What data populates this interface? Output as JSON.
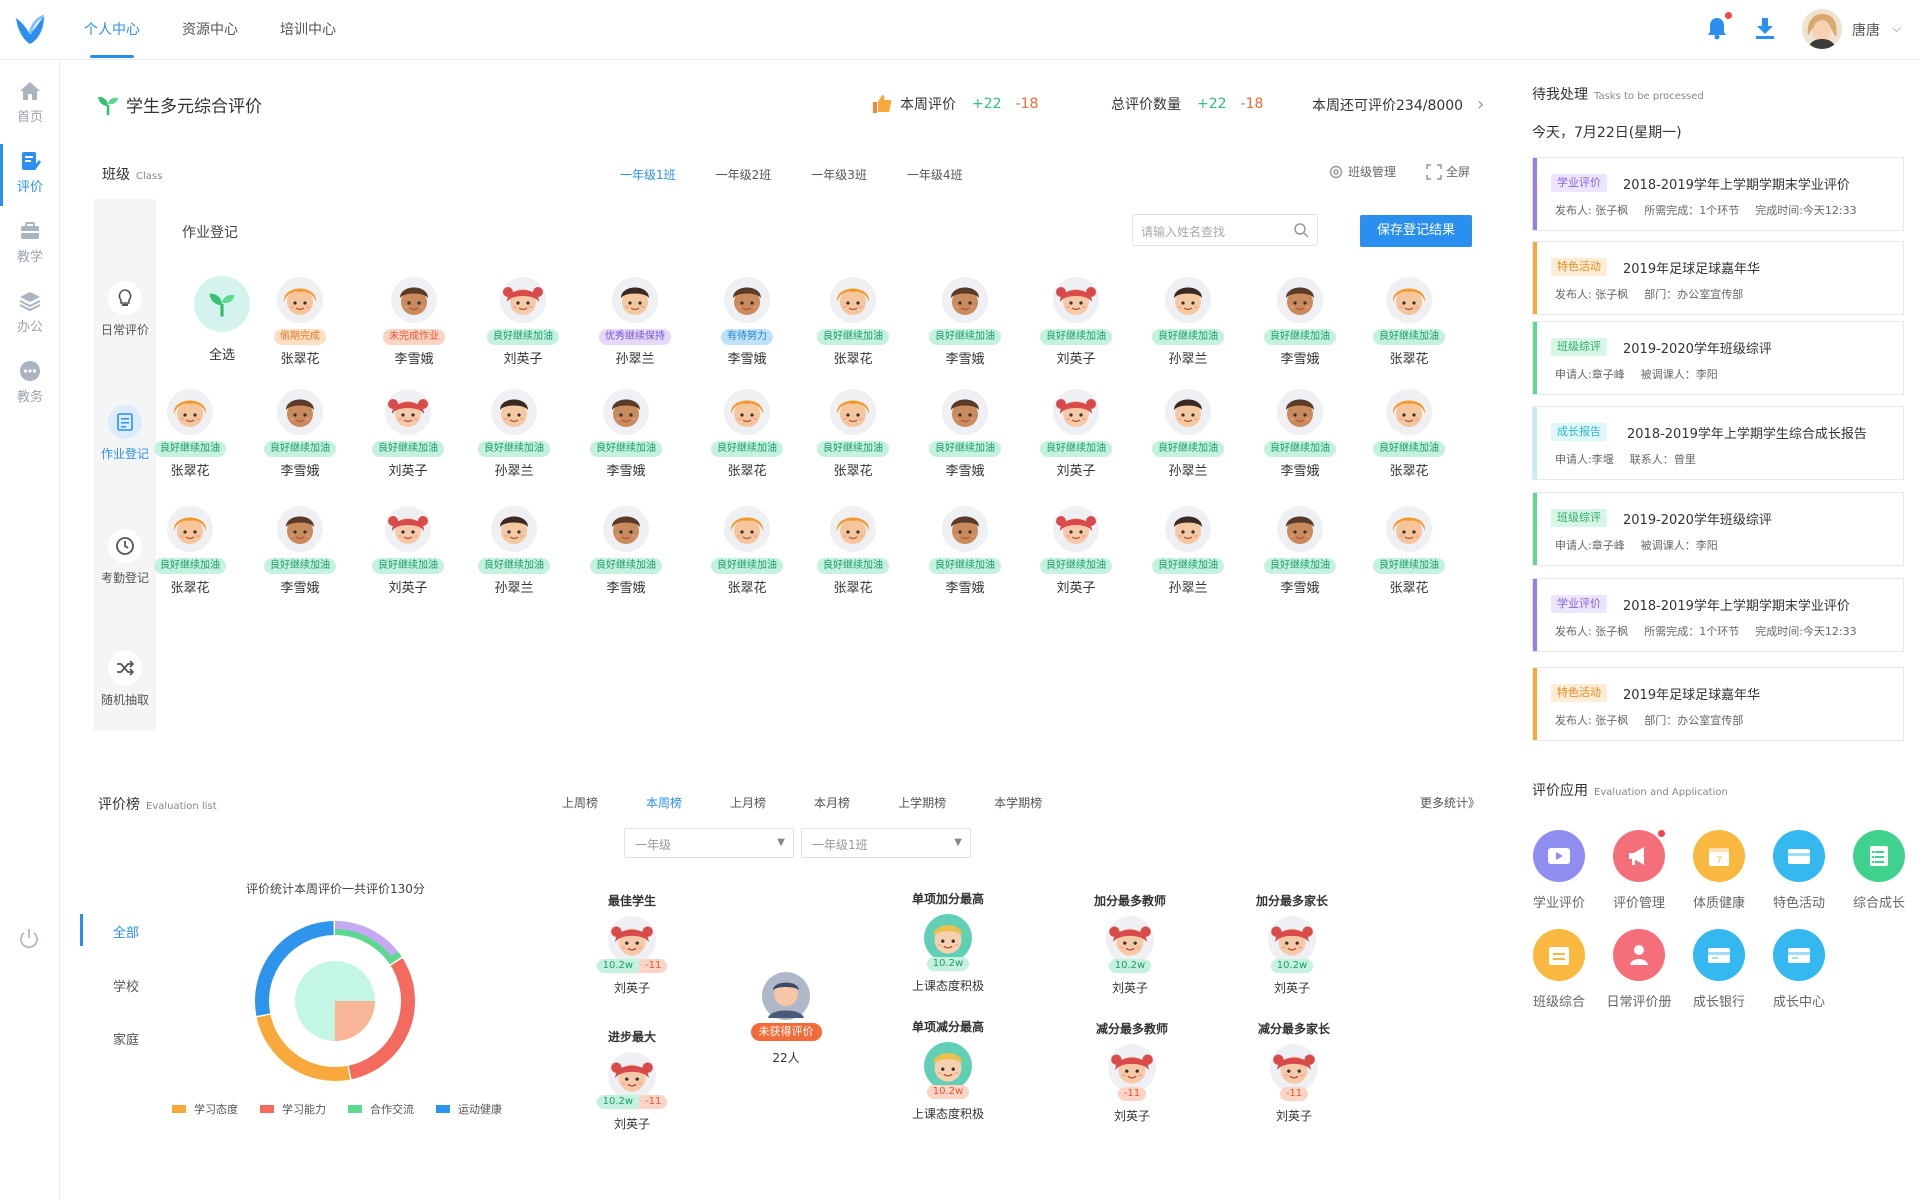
{
  "topbar": {
    "tabs": [
      "个人中心",
      "资源中心",
      "培训中心"
    ],
    "user_name": "唐唐"
  },
  "leftnav": {
    "items": [
      {
        "label": "首页",
        "icon": "home-icon"
      },
      {
        "label": "评价",
        "icon": "edit-doc-icon",
        "active": true
      },
      {
        "label": "教学",
        "icon": "briefcase-icon"
      },
      {
        "label": "办公",
        "icon": "layers-icon"
      },
      {
        "label": "教务",
        "icon": "chat-dots-icon"
      }
    ]
  },
  "header": {
    "title": "学生多元综合评价",
    "week_eval_label": "本周评价",
    "week_eval_plus": "+22",
    "week_eval_minus": "-18",
    "total_label": "总评价数量",
    "total_plus": "+22",
    "total_minus": "-18",
    "remaining": "本周还可评价234/8000"
  },
  "class_section": {
    "title": "班级",
    "title_en": "Class",
    "tabs": [
      "一年级1班",
      "一年级2班",
      "一年级3班",
      "一年级4班"
    ],
    "manage": "班级管理",
    "fullscreen": "全屏"
  },
  "panel": {
    "items": [
      "日常评价",
      "作业登记",
      "考勤登记",
      "随机抽取"
    ],
    "hw_title": "作业登记",
    "search_placeholder": "请输入姓名查找",
    "save_button": "保存登记结果",
    "select_all": "全选"
  },
  "students": [
    [
      {
        "name": "张翠花",
        "badge": "偷期完成",
        "type": "orange",
        "face": "girl-orange"
      },
      {
        "name": "李雪娥",
        "badge": "未完成作业",
        "type": "orange2",
        "face": "boy-brown"
      },
      {
        "name": "刘英子",
        "badge": "良好继续加油",
        "type": "green",
        "face": "girl-red"
      },
      {
        "name": "孙翠兰",
        "badge": "优秀继续保持",
        "type": "purple",
        "face": "boy-black"
      },
      {
        "name": "李雪娥",
        "badge": "有待努力",
        "type": "blue",
        "face": "boy-brown"
      },
      {
        "name": "张翠花",
        "badge": "良好继续加油",
        "type": "green",
        "face": "girl-orange"
      },
      {
        "name": "李雪娥",
        "badge": "良好继续加油",
        "type": "green",
        "face": "boy-brown"
      },
      {
        "name": "刘英子",
        "badge": "良好继续加油",
        "type": "green",
        "face": "girl-red"
      },
      {
        "name": "孙翠兰",
        "badge": "良好继续加油",
        "type": "green",
        "face": "boy-black"
      },
      {
        "name": "李雪娥",
        "badge": "良好继续加油",
        "type": "green",
        "face": "boy-brown"
      },
      {
        "name": "张翠花",
        "badge": "良好继续加油",
        "type": "green",
        "face": "girl-orange"
      }
    ],
    [
      {
        "name": "张翠花",
        "badge": "良好继续加油",
        "type": "green",
        "face": "girl-orange"
      },
      {
        "name": "李雪娥",
        "badge": "良好继续加油",
        "type": "green",
        "face": "boy-brown"
      },
      {
        "name": "刘英子",
        "badge": "良好继续加油",
        "type": "green",
        "face": "girl-red"
      },
      {
        "name": "孙翠兰",
        "badge": "良好继续加油",
        "type": "green",
        "face": "boy-black"
      },
      {
        "name": "李雪娥",
        "badge": "良好继续加油",
        "type": "green",
        "face": "boy-brown"
      },
      {
        "name": "张翠花",
        "badge": "良好继续加油",
        "type": "green",
        "face": "girl-orange"
      },
      {
        "name": "张翠花",
        "badge": "良好继续加油",
        "type": "green",
        "face": "girl-orange"
      },
      {
        "name": "李雪娥",
        "badge": "良好继续加油",
        "type": "green",
        "face": "boy-brown"
      },
      {
        "name": "刘英子",
        "badge": "良好继续加油",
        "type": "green",
        "face": "girl-red"
      },
      {
        "name": "孙翠兰",
        "badge": "良好继续加油",
        "type": "green",
        "face": "boy-black"
      },
      {
        "name": "李雪娥",
        "badge": "良好继续加油",
        "type": "green",
        "face": "boy-brown"
      },
      {
        "name": "张翠花",
        "badge": "良好继续加油",
        "type": "green",
        "face": "girl-orange"
      }
    ],
    [
      {
        "name": "张翠花",
        "badge": "良好继续加油",
        "type": "green",
        "face": "girl-orange"
      },
      {
        "name": "李雪娥",
        "badge": "良好继续加油",
        "type": "green",
        "face": "boy-brown"
      },
      {
        "name": "刘英子",
        "badge": "良好继续加油",
        "type": "green",
        "face": "girl-red"
      },
      {
        "name": "孙翠兰",
        "badge": "良好继续加油",
        "type": "green",
        "face": "boy-black"
      },
      {
        "name": "李雪娥",
        "badge": "良好继续加油",
        "type": "green",
        "face": "boy-brown"
      },
      {
        "name": "张翠花",
        "badge": "良好继续加油",
        "type": "green",
        "face": "girl-orange"
      },
      {
        "name": "张翠花",
        "badge": "良好继续加油",
        "type": "green",
        "face": "girl-orange"
      },
      {
        "name": "李雪娥",
        "badge": "良好继续加油",
        "type": "green",
        "face": "boy-brown"
      },
      {
        "name": "刘英子",
        "badge": "良好继续加油",
        "type": "green",
        "face": "girl-red"
      },
      {
        "name": "孙翠兰",
        "badge": "良好继续加油",
        "type": "green",
        "face": "boy-black"
      },
      {
        "name": "李雪娥",
        "badge": "良好继续加油",
        "type": "green",
        "face": "boy-brown"
      },
      {
        "name": "张翠花",
        "badge": "良好继续加油",
        "type": "green",
        "face": "girl-orange"
      }
    ]
  ],
  "ranking": {
    "title": "评价榜",
    "title_en": "Evaluation list",
    "tabs": [
      "上周榜",
      "本周榜",
      "上月榜",
      "本月榜",
      "上学期榜",
      "本学期榜"
    ],
    "active_tab": "本周榜",
    "grade_select": "一年级",
    "class_select": "一年级1班",
    "more": "更多统计》",
    "scopes": [
      "全部",
      "学校",
      "家庭"
    ],
    "pie_caption": "评价统计本周评价一共评价130分",
    "legend": [
      "学习态度",
      "学习能力",
      "合作交流",
      "运动健康"
    ],
    "awards": {
      "best_student": {
        "label": "最佳学生",
        "plus": "10.2w",
        "minus": "-11",
        "name": "刘英子"
      },
      "most_progress": {
        "label": "进步最大",
        "plus": "10.2w",
        "minus": "-11",
        "name": "刘英子"
      },
      "no_eval": {
        "badge": "未获得评价",
        "count": "22人"
      },
      "single_plus_top": {
        "label": "单项加分最高",
        "value": "10.2w",
        "name": "上课态度积极"
      },
      "single_minus_top": {
        "label": "单项减分最高",
        "value": "10.2w",
        "name": "上课态度积极"
      },
      "most_plus_teacher": {
        "label": "加分最多教师",
        "value": "10.2w",
        "name": "刘英子"
      },
      "most_plus_parent": {
        "label": "加分最多家长",
        "value": "10.2w",
        "name": "刘英子"
      },
      "most_minus_teacher": {
        "label": "减分最多教师",
        "value": "-11",
        "name": "刘英子"
      },
      "most_minus_parent": {
        "label": "减分最多家长",
        "value": "-11",
        "name": "刘英子"
      }
    }
  },
  "chart_data": {
    "type": "pie",
    "categories": [
      "学习态度",
      "学习能力",
      "合作交流",
      "运动健康"
    ],
    "colors": [
      "#f7a93b",
      "#f36b5f",
      "#5cd98e",
      "#2e93ea"
    ],
    "outer_ring_values": [
      25,
      31,
      16,
      28
    ],
    "inner_values": [
      25,
      75
    ],
    "inner_colors": [
      "#f8b597",
      "#c4f6e6"
    ]
  },
  "right": {
    "title": "待我处理",
    "title_en": "Tasks to be processed",
    "date": "今天，7月22日(星期一)",
    "tasks": [
      {
        "tag": "学业评价",
        "kind": "purple",
        "title": "2018-2019学年上学期学期末学业评价",
        "sub": [
          "发布人: 张子枫",
          "所需完成：1个环节",
          "完成时间:今天12:33"
        ]
      },
      {
        "tag": "特色活动",
        "kind": "orange",
        "title": "2019年足球足球嘉年华",
        "sub": [
          "发布人: 张子枫",
          "部门：办公室宣传部"
        ]
      },
      {
        "tag": "班级综评",
        "kind": "green",
        "title": "2019-2020学年班级综评",
        "sub": [
          "申请人:章子峰",
          "被调课人：李阳"
        ]
      },
      {
        "tag": "成长报告",
        "kind": "cyan",
        "title": "2018-2019学年上学期学生综合成长报告",
        "sub": [
          "申请人:李堰",
          "联系人：曾里"
        ]
      },
      {
        "tag": "班级综评",
        "kind": "green",
        "title": "2019-2020学年班级综评",
        "sub": [
          "申请人:章子峰",
          "被调课人：李阳"
        ]
      },
      {
        "tag": "学业评价",
        "kind": "purple",
        "title": "2018-2019学年上学期学期末学业评价",
        "sub": [
          "发布人: 张子枫",
          "所需完成：1个环节",
          "完成时间:今天12:33"
        ]
      },
      {
        "tag": "特色活动",
        "kind": "orange",
        "title": "2019年足球足球嘉年华",
        "sub": [
          "发布人: 张子枫",
          "部门：办公室宣传部"
        ]
      }
    ],
    "apps_title": "评价应用",
    "apps_title_en": "Evaluation and Application",
    "apps": [
      {
        "label": "学业评价",
        "icon": "video-play-icon",
        "color": "#8f8ef0"
      },
      {
        "label": "评价管理",
        "icon": "megaphone-icon",
        "color": "#f56f7b",
        "dot": true
      },
      {
        "label": "体质健康",
        "icon": "calendar-icon",
        "color": "#f9b840"
      },
      {
        "label": "特色活动",
        "icon": "card-icon",
        "color": "#35b8ef"
      },
      {
        "label": "综合成长",
        "icon": "checklist-icon",
        "color": "#3fd18d"
      },
      {
        "label": "班级综合",
        "icon": "calendar-list-icon",
        "color": "#f9b840"
      },
      {
        "label": "日常评价册",
        "icon": "person-icon",
        "color": "#f56f7b"
      },
      {
        "label": "成长银行",
        "icon": "wallet-icon",
        "color": "#35b8ef"
      },
      {
        "label": "成长中心",
        "icon": "wallet-icon",
        "color": "#35b8ef"
      }
    ]
  }
}
